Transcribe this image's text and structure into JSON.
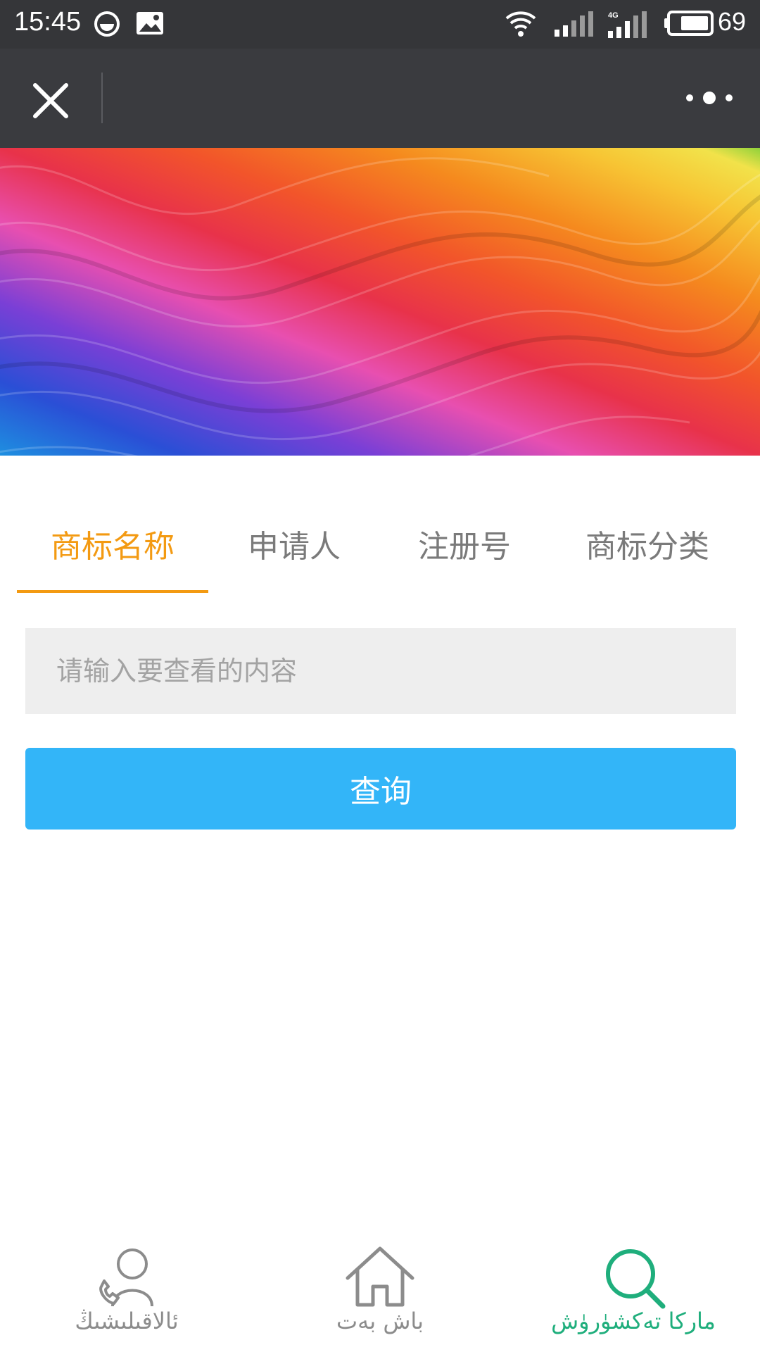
{
  "status_bar": {
    "time": "15:45",
    "network": "4G",
    "battery_level": "69",
    "icons": [
      "face-icon",
      "image-icon",
      "wifi-icon",
      "signal-icon",
      "signal-4g-icon",
      "battery-icon"
    ]
  },
  "title_bar": {
    "close_icon": "close-icon",
    "more_icon": "more-icon"
  },
  "tabs": [
    {
      "label": "商标名称",
      "active": true
    },
    {
      "label": "申请人",
      "active": false
    },
    {
      "label": "注册号",
      "active": false
    },
    {
      "label": "商标分类",
      "active": false
    }
  ],
  "search": {
    "placeholder": "请输入要查看的内容",
    "value": ""
  },
  "query_button": {
    "label": "查询"
  },
  "bottom_nav": [
    {
      "label": "ئالاقىلىشىڭ",
      "icon": "contact-phone-icon",
      "active": false
    },
    {
      "label": "باش بەت",
      "icon": "home-icon",
      "active": false
    },
    {
      "label": "ماركا تەكشۈرۈش",
      "icon": "search-icon",
      "active": true
    }
  ],
  "colors": {
    "accent_orange": "#f39a12",
    "button_blue": "#33b5f8",
    "active_green": "#1fae7c",
    "titlebar": "#3a3b3f",
    "statusbar": "#353639"
  }
}
